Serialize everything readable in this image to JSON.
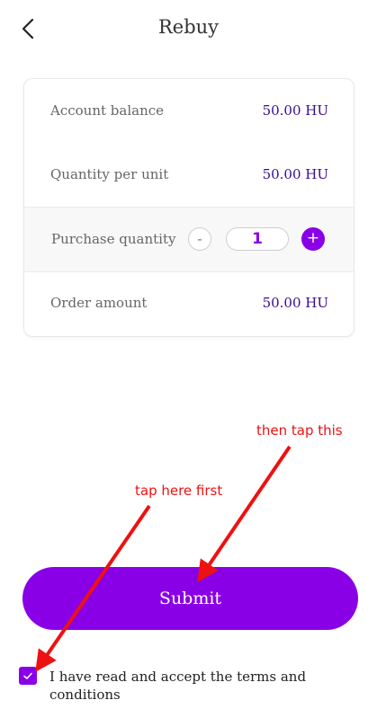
{
  "header": {
    "title": "Rebuy",
    "back_icon": "chevron-left-icon"
  },
  "summary": {
    "account_balance": {
      "label": "Account balance",
      "value": "50.00 HU"
    },
    "quantity_per_unit": {
      "label": "Quantity per unit",
      "value": "50.00 HU"
    },
    "purchase_quantity": {
      "label": "Purchase quantity",
      "value": "1",
      "minus_label": "-",
      "plus_label": "+"
    },
    "order_amount": {
      "label": "Order amount",
      "value": "50.00 HU"
    }
  },
  "submit": {
    "label": "Submit"
  },
  "terms": {
    "checked": true,
    "label": "I have read and accept the terms and conditions"
  },
  "annotations": {
    "second": "then tap this",
    "first": "tap here first"
  },
  "colors": {
    "accent": "#8a00e6",
    "value_text": "#3a0b8f",
    "annotation": "#ee1111"
  }
}
